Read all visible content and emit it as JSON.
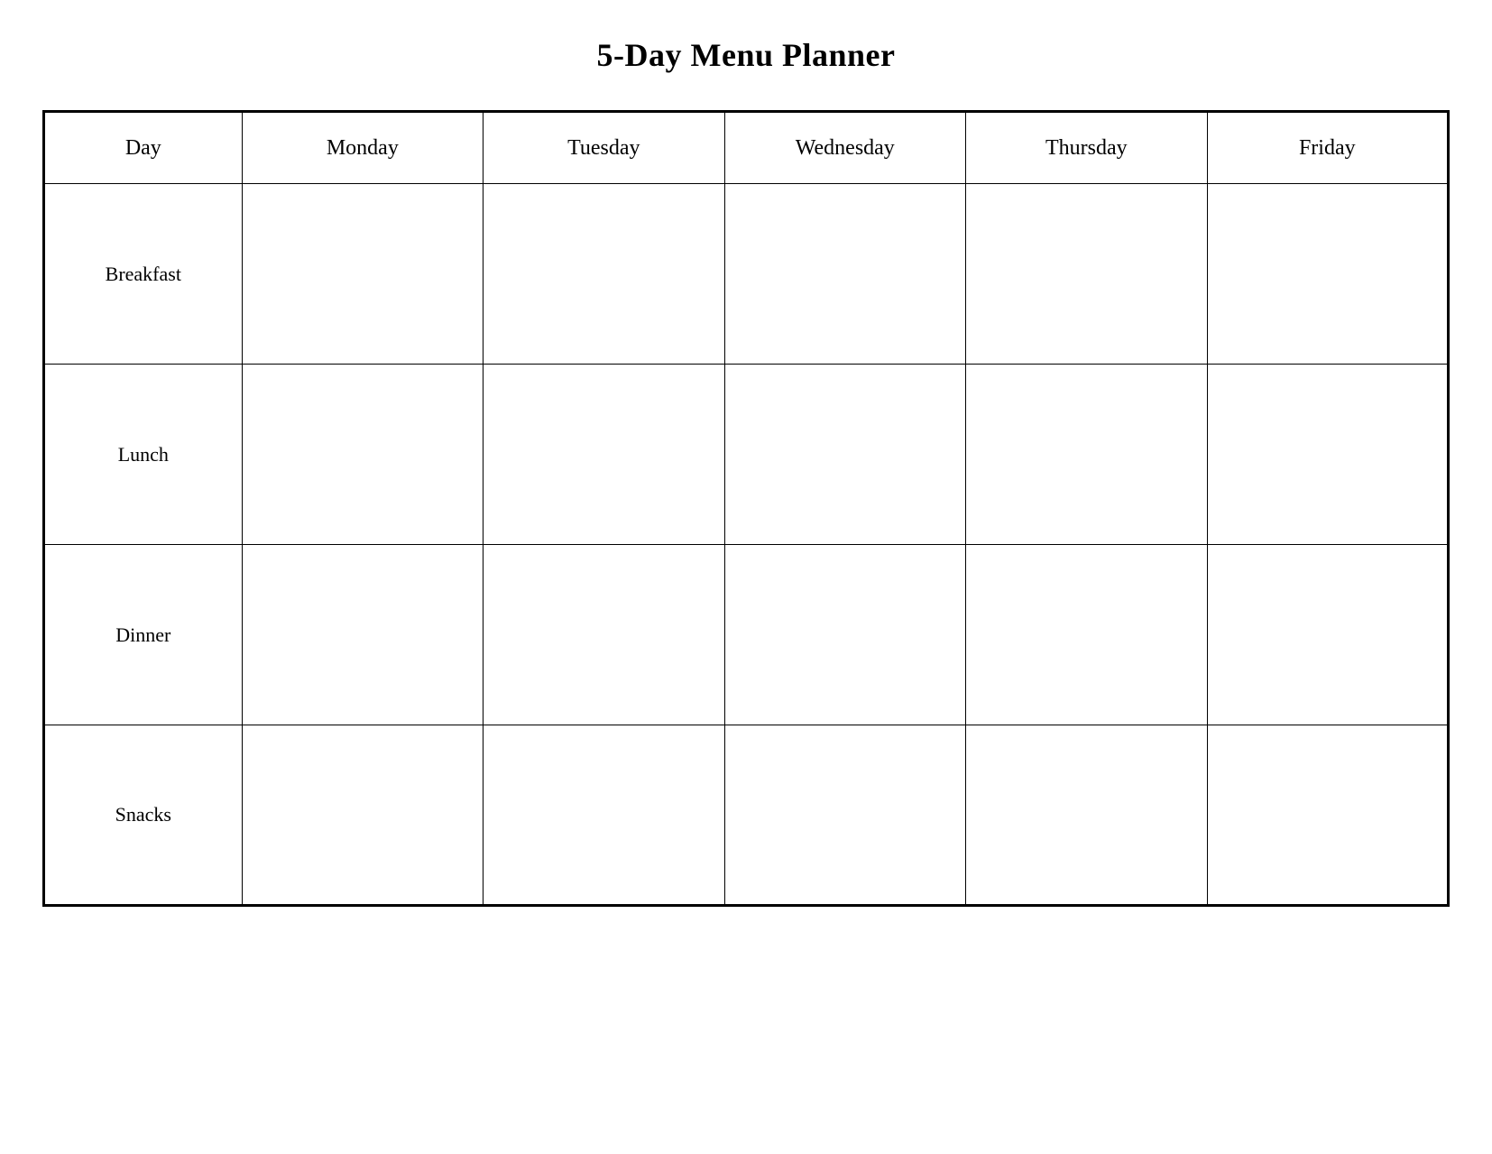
{
  "title": "5-Day Menu Planner",
  "headers": {
    "col0": "Day",
    "col1": "Monday",
    "col2": "Tuesday",
    "col3": "Wednesday",
    "col4": "Thursday",
    "col5": "Friday"
  },
  "rows": [
    {
      "label": "Breakfast",
      "monday": "",
      "tuesday": "",
      "wednesday": "",
      "thursday": "",
      "friday": ""
    },
    {
      "label": "Lunch",
      "monday": "",
      "tuesday": "",
      "wednesday": "",
      "thursday": "",
      "friday": ""
    },
    {
      "label": "Dinner",
      "monday": "",
      "tuesday": "",
      "wednesday": "",
      "thursday": "",
      "friday": ""
    },
    {
      "label": "Snacks",
      "monday": "",
      "tuesday": "",
      "wednesday": "",
      "thursday": "",
      "friday": ""
    }
  ]
}
